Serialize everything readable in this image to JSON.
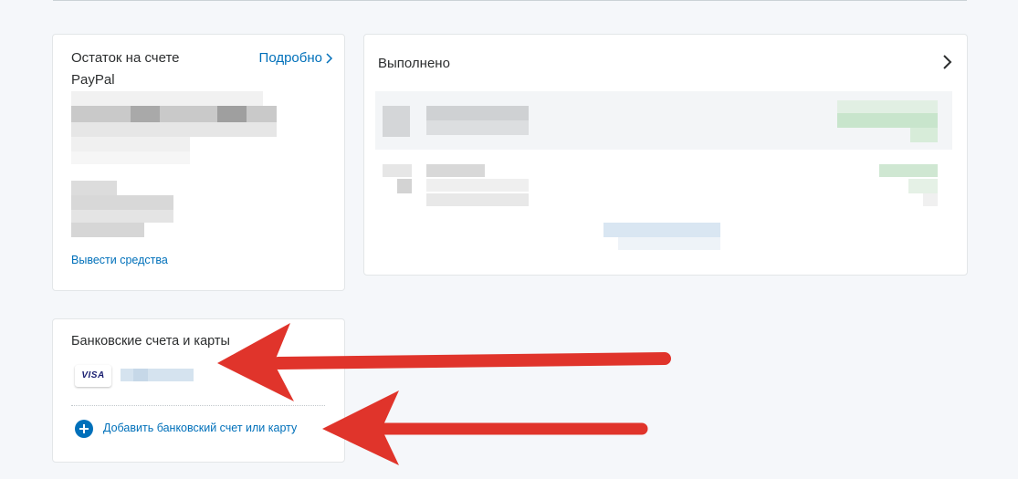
{
  "balance": {
    "title": "Остаток на счете PayPal",
    "more_link": "Подробно",
    "withdraw_link": "Вывести средства"
  },
  "activity": {
    "title": "Выполнено"
  },
  "banks": {
    "title": "Банковские счета и карты",
    "card_brand": "VISA",
    "add_link": "Добавить банковский счет или карту"
  },
  "annotation_arrows": {
    "color": "#e0342b"
  },
  "colors": {
    "link": "#0070ba",
    "background": "#f5f7fa",
    "card": "#ffffff"
  }
}
